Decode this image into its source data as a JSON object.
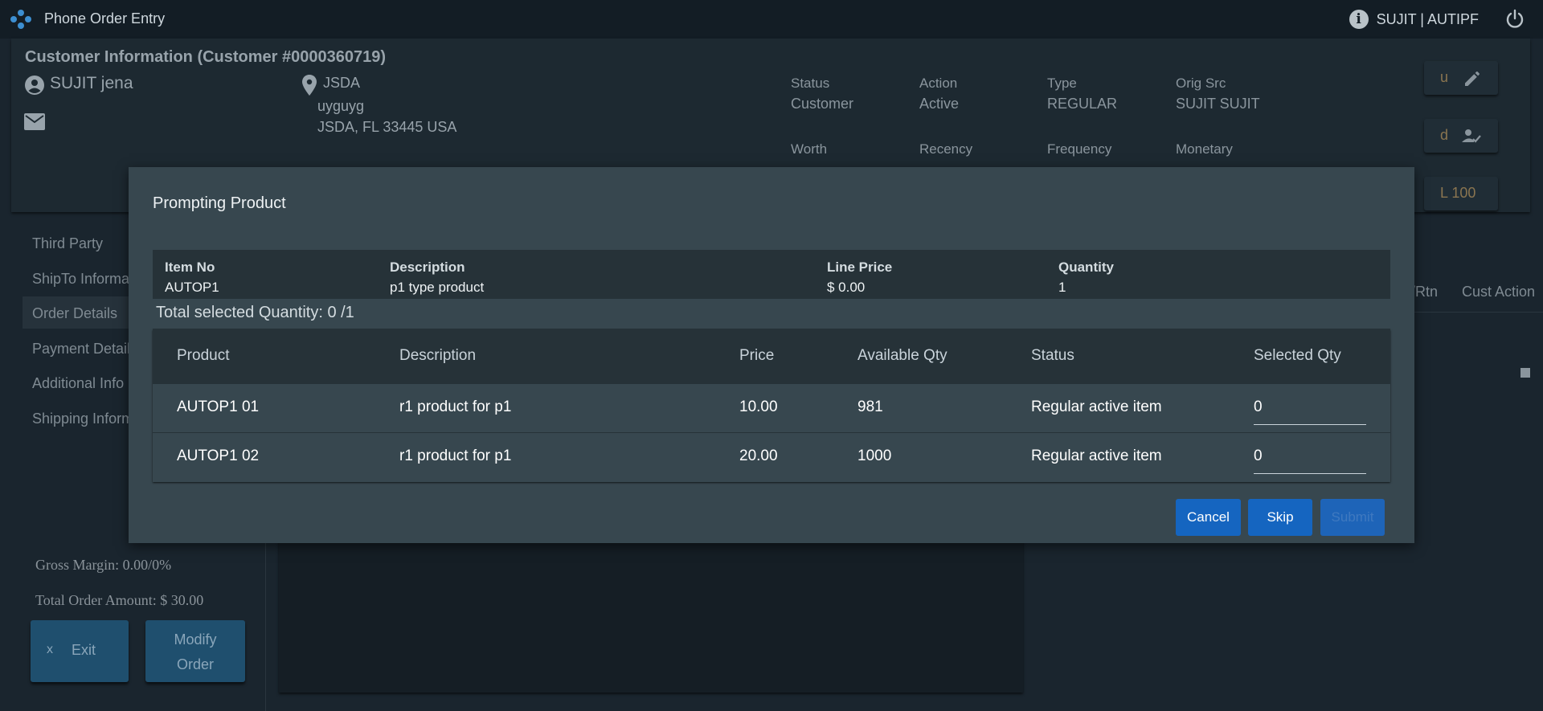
{
  "app": {
    "title": "Phone Order Entry",
    "user": "SUJIT | AUTIPF",
    "info_icon_glyph": "i"
  },
  "customer": {
    "heading": "Customer Information (Customer #0000360719)",
    "name": "SUJIT jena",
    "address_name": "JSDA",
    "address_line1": "uyguyg",
    "address_line2": "JSDA, FL 33445 USA",
    "stats": [
      {
        "label": "Status",
        "value": "Customer"
      },
      {
        "label": "Action",
        "value": "Active"
      },
      {
        "label": "Type",
        "value": "REGULAR"
      },
      {
        "label": "Orig Src",
        "value": "SUJIT SUJIT"
      },
      {
        "label": "Worth",
        "value": ""
      },
      {
        "label": "Recency",
        "value": ""
      },
      {
        "label": "Frequency",
        "value": ""
      },
      {
        "label": "Monetary",
        "value": ""
      }
    ],
    "side_buttons": [
      {
        "label": "u",
        "icon": "edit-icon"
      },
      {
        "label": "d",
        "icon": "person-check-icon"
      },
      {
        "label": "L 100",
        "icon": ""
      }
    ]
  },
  "nav": {
    "items": [
      {
        "label": "Third Party"
      },
      {
        "label": "ShipTo Informa"
      },
      {
        "label": "Order Details"
      },
      {
        "label": "Payment Detail"
      },
      {
        "label": "Additional Info"
      },
      {
        "label": "Shipping Inform"
      }
    ],
    "active_index": 2,
    "gross_margin": "Gross Margin: 0.00/0%",
    "total_order": "Total Order Amount: $ 30.00",
    "exit_x": "x",
    "exit_label": "Exit",
    "modify_line1": "Modify",
    "modify_line2": "Order"
  },
  "tabs": {
    "rtn": "/Rtn",
    "cust_action": "Cust Action"
  },
  "modal": {
    "title": "Prompting Product",
    "summary": {
      "item_no_label": "Item No",
      "item_no": "AUTOP1",
      "description_label": "Description",
      "description": "p1 type product",
      "line_price_label": "Line Price",
      "line_price": "$ 0.00",
      "quantity_label": "Quantity",
      "quantity": "1"
    },
    "total_selected": "Total selected Quantity: 0 /1",
    "columns": [
      "Product",
      "Description",
      "Price",
      "Available Qty",
      "Status",
      "Selected Qty"
    ],
    "rows": [
      {
        "product": "AUTOP1 01",
        "description": "r1 product for p1",
        "price": "10.00",
        "available": "981",
        "status": "Regular active item",
        "selected": "0"
      },
      {
        "product": "AUTOP1 02",
        "description": "r1 product for p1",
        "price": "20.00",
        "available": "1000",
        "status": "Regular active item",
        "selected": "0"
      }
    ],
    "buttons": {
      "cancel": "Cancel",
      "skip": "Skip",
      "submit": "Submit"
    }
  },
  "colors": {
    "primary_button": "#1565c0",
    "modal_bg": "#37474f",
    "header_bg": "#263238",
    "logo": "#3d8fd1"
  }
}
